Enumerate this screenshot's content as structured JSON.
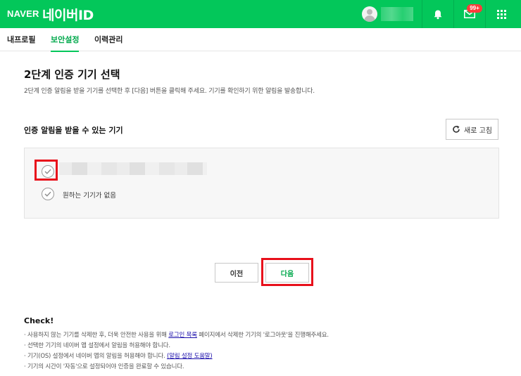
{
  "header": {
    "logo": "NAVER",
    "service_title": "네이버ID",
    "mail_badge": "99+",
    "colors": {
      "brand": "#03c75a",
      "badge": "#ff3b3b"
    },
    "icons": [
      "user-avatar-icon",
      "bell-icon",
      "mail-icon",
      "apps-grid-icon"
    ]
  },
  "tabs": [
    {
      "label": "내프로필",
      "active": false
    },
    {
      "label": "보안설정",
      "active": true
    },
    {
      "label": "이력관리",
      "active": false
    }
  ],
  "main": {
    "title": "2단계 인증 기기 선택",
    "description": "2단계 인증 알림을 받을 기기를 선택한 후 [다음] 버튼을 클릭해 주세요. 기기를 확인하기 위한 알림을 발송합니다.",
    "section_title": "인증 알림을 받을 수 있는 기기",
    "refresh_label": "새로 고침",
    "no_device_label": "원하는 기기가 없음",
    "prev_label": "이전",
    "next_label": "다음"
  },
  "check": {
    "title": "Check!",
    "line1_before": "· 사용하지 않는 기기를 삭제한 후, 더욱 안전한 사용을 위해 ",
    "line1_link": "로그인 목록",
    "line1_after": " 페이지에서 삭제한 기기의 '로그아웃'을 진행해주세요.",
    "line2": "· 선택한 기기의 네이버 앱 설정에서 알림을 허용해야 합니다.",
    "line3_before": "· 기기(OS) 설정에서 네이버 앱의 알림을 허용해야 합니다. ",
    "line3_link": "(알림 설정 도움말)",
    "line4": "· 기기의 시간이 '자동'으로 설정되어야 인증을 완료할 수 있습니다."
  }
}
